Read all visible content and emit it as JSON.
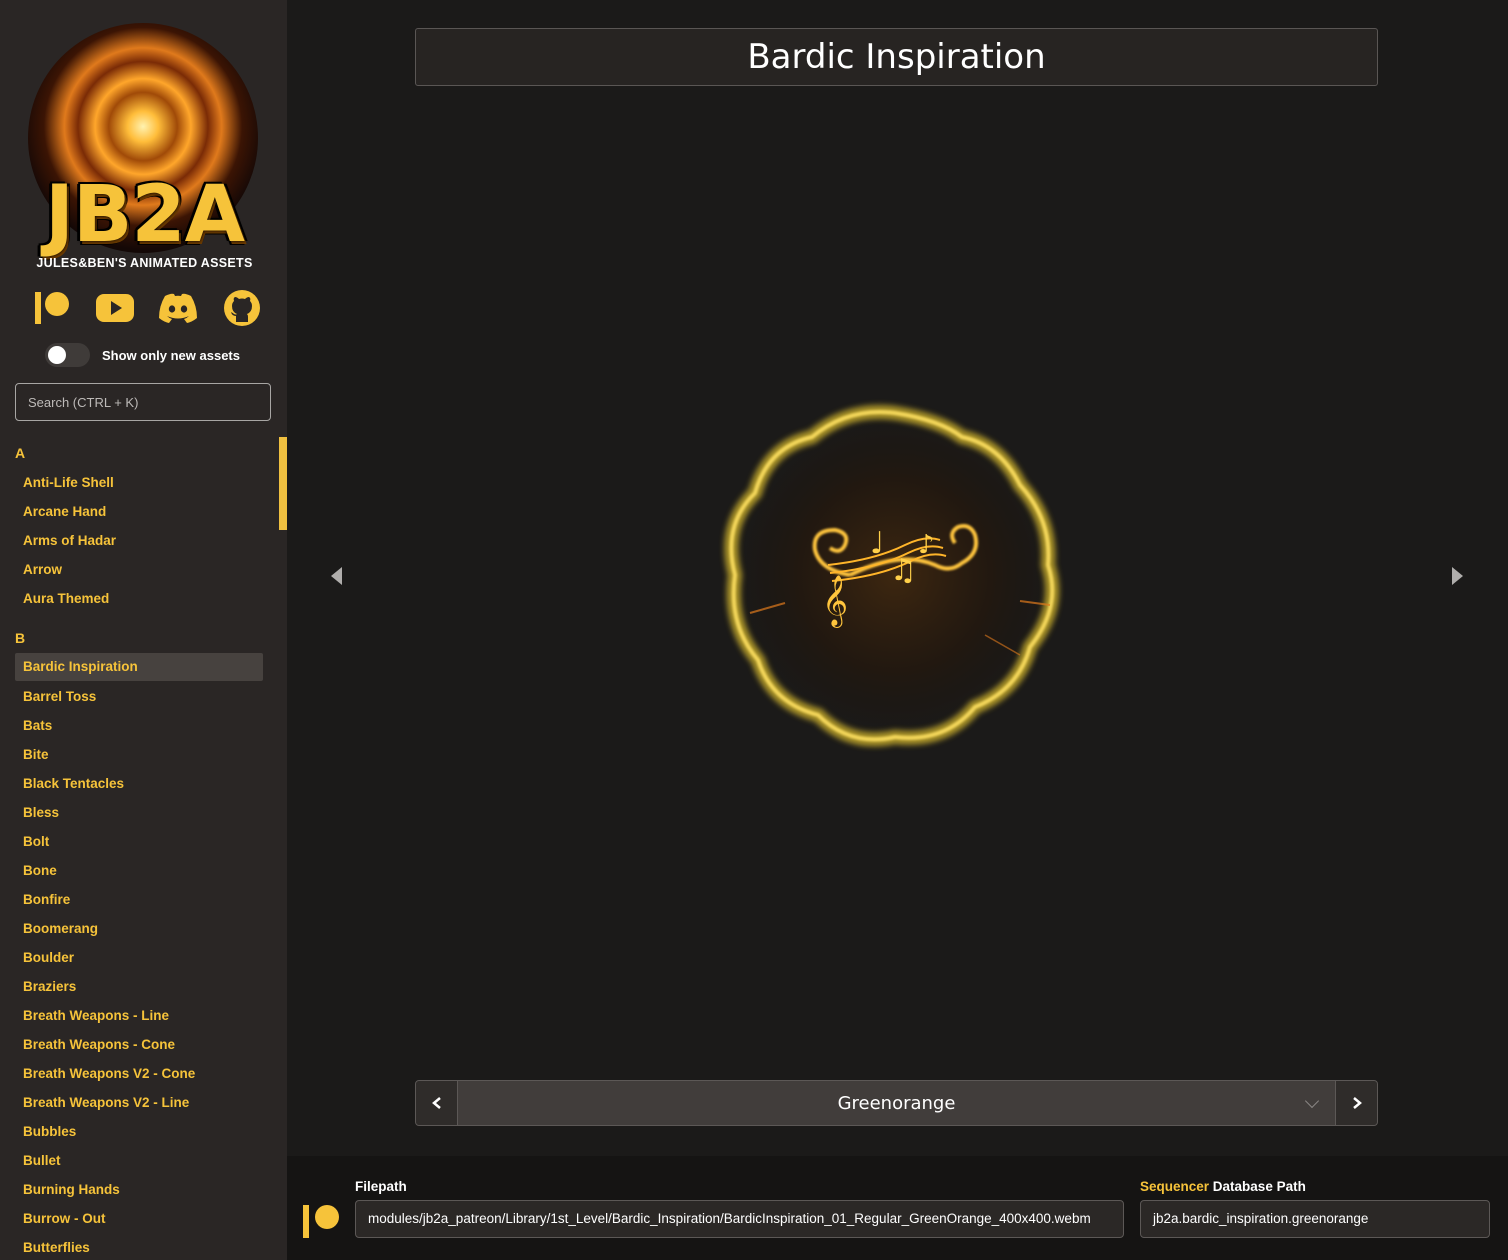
{
  "brand": {
    "logo_text": "JB2A",
    "logo_subtitle": "JULES&BEN'S ANIMATED ASSETS",
    "accent_color": "#f6c33a"
  },
  "social_links": [
    {
      "icon": "patreon-icon"
    },
    {
      "icon": "youtube-icon"
    },
    {
      "icon": "discord-icon"
    },
    {
      "icon": "github-icon"
    }
  ],
  "filter": {
    "toggle_label": "Show only new assets",
    "toggle_on": false
  },
  "search": {
    "placeholder": "Search (CTRL + K)"
  },
  "asset_list": {
    "groups": [
      {
        "letter": "A",
        "items": [
          "Anti-Life Shell",
          "Arcane Hand",
          "Arms of Hadar",
          "Arrow",
          "Aura Themed"
        ]
      },
      {
        "letter": "B",
        "items": [
          "Bardic Inspiration",
          "Barrel Toss",
          "Bats",
          "Bite",
          "Black Tentacles",
          "Bless",
          "Bolt",
          "Bone",
          "Bonfire",
          "Boomerang",
          "Boulder",
          "Braziers",
          "Breath Weapons - Line",
          "Breath Weapons - Cone",
          "Breath Weapons V2 - Cone",
          "Breath Weapons V2 - Line",
          "Bubbles",
          "Bullet",
          "Burning Hands",
          "Burrow - Out",
          "Butterflies"
        ]
      }
    ],
    "selected": "Bardic Inspiration"
  },
  "main": {
    "title": "Bardic Inspiration",
    "variant": "Greenorange"
  },
  "footer": {
    "filepath_label": "Filepath",
    "filepath": "modules/jb2a_patreon/Library/1st_Level/Bardic_Inspiration/BardicInspiration_01_Regular_GreenOrange_400x400.webm",
    "db_label_accent": "Sequencer",
    "db_label_rest": "Database Path",
    "db_path": "jb2a.bardic_inspiration.greenorange"
  }
}
